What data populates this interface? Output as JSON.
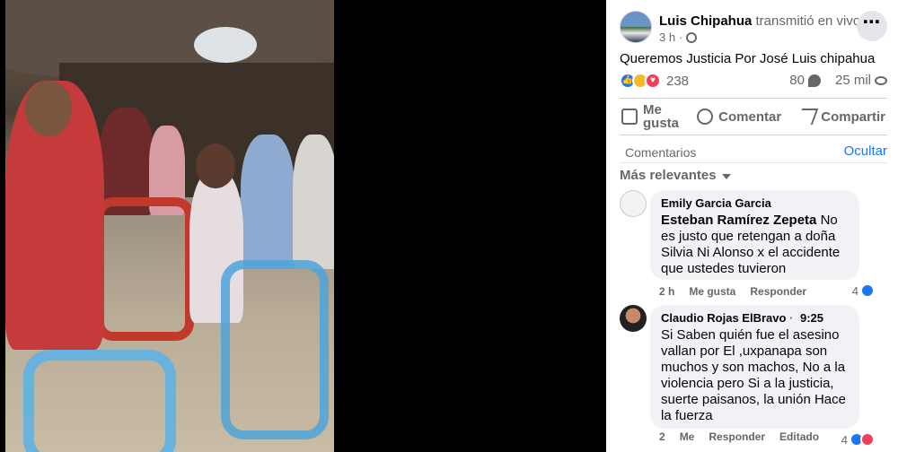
{
  "post": {
    "author": "Luis Chipahua",
    "action": "transmitió en vivo.",
    "time": "3 h",
    "privacy_icon": "globe-icon",
    "text": "Queremos Justicia Por José Luis chipahua"
  },
  "stats": {
    "reaction_icons": [
      "like",
      "sad",
      "love"
    ],
    "reaction_count": "238",
    "comment_count": "80",
    "view_count": "25 mil"
  },
  "actions": {
    "like": "Me gusta",
    "comment": "Comentar",
    "share": "Compartir"
  },
  "comments_section": {
    "title": "Comentarios",
    "hide": "Ocultar",
    "sort": "Más relevantes"
  },
  "comments": [
    {
      "author": "Emily Garcia Garcia",
      "mention": "Esteban Ramírez Zepeta",
      "text": "No es justo que retengan a doña Silvia Ni Alonso x el accidente que ustedes tuvieron",
      "time": "2 h",
      "like": "Me gusta",
      "reply": "Responder",
      "reactions": "4"
    },
    {
      "author": "Claudio Rojas ElBravo",
      "timestamp": "9:25",
      "text": "Si Saben quién fue el asesino vallan por El ,uxpanapa son muchos y son machos, No a la violencia pero Si a la justicia, suerte paisanos, la unión Hace la fuerza",
      "time": "2",
      "like": "Me",
      "reply": "Responder",
      "edited": "Editado",
      "reactions": "4"
    }
  ],
  "colors": {
    "accent": "#1877f2",
    "muted": "#65676b",
    "bubble": "#f0f2f5"
  }
}
